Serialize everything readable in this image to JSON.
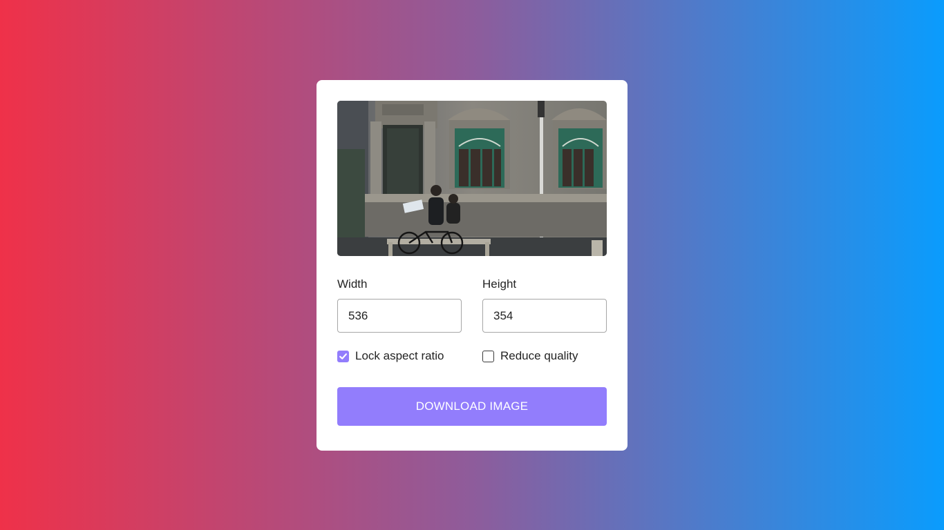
{
  "card": {
    "preview_image": "photo of a cyclist passing an ornate old building facade with green windows",
    "width": {
      "label": "Width",
      "value": "536"
    },
    "height": {
      "label": "Height",
      "value": "354"
    },
    "lock_ratio": {
      "label": "Lock aspect ratio",
      "checked": true
    },
    "reduce_quality": {
      "label": "Reduce quality",
      "checked": false
    },
    "download_label": "DOWNLOAD IMAGE"
  },
  "colors": {
    "gradient_start": "#EF3149",
    "gradient_end": "#0A9CFD",
    "accent": "#927DFC",
    "card": "#FFFFFF"
  }
}
